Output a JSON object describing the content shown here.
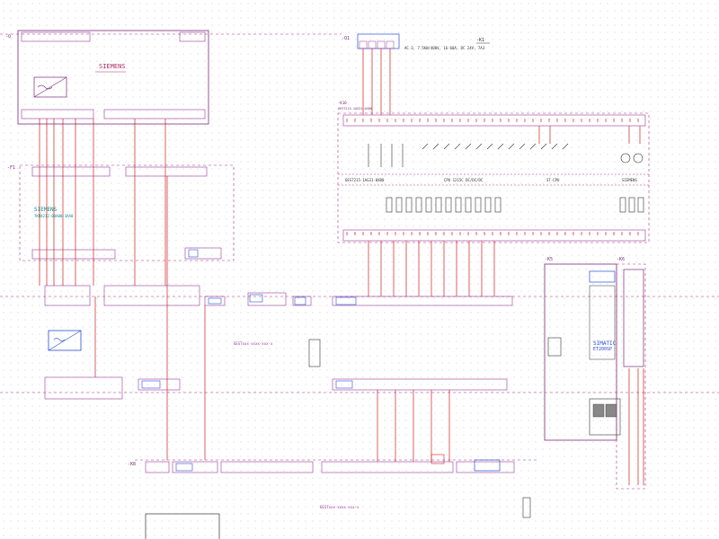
{
  "colors": {
    "background": "#ffffff",
    "grid_dot": "#c9c9c9",
    "device_outline": "#7a2a7a",
    "terminal": "#9a3a9a",
    "wire": "#d02020",
    "cable_blue": "#2a4fd8",
    "dashed_border": "#b0307a",
    "text_dark": "#333333",
    "logo_teal": "#0a8a8a",
    "logo_pink": "#b02a6a"
  },
  "devices": {
    "q_label": "-Q",
    "q_logo": "SIEMENS",
    "q_breaker_tag": "-Q1",
    "breaker_spec": "AC-3, 7.5KW/400V, 16-60A, DC 24V, 7A3",
    "breaker_tag_right": "-K1",
    "f_label": "-F1",
    "f_logo": "SIEMENS",
    "f_part": "7KM4212-0BA00-3AA0",
    "plc_tag": "-K10",
    "plc_part": "6ES7215-1AG31-0XB0",
    "plc_header_1": "6ES7215-1AG31-0XB0",
    "plc_header_2": "CPU 1215C DC/DC/DC",
    "plc_header_3": "ST-CPU",
    "plc_header_4": "SIEMENS",
    "k5_tag": "-K5",
    "k6_tag": "-K6",
    "simatic_1": "SIMATIC",
    "simatic_2": "ET200SP",
    "k8_tag": "-K8",
    "bus_label_1": "6ES7xxx-xxxx-xxx-x",
    "bus_label_2": "6ES7xxx-xxxx-xxx-x"
  }
}
